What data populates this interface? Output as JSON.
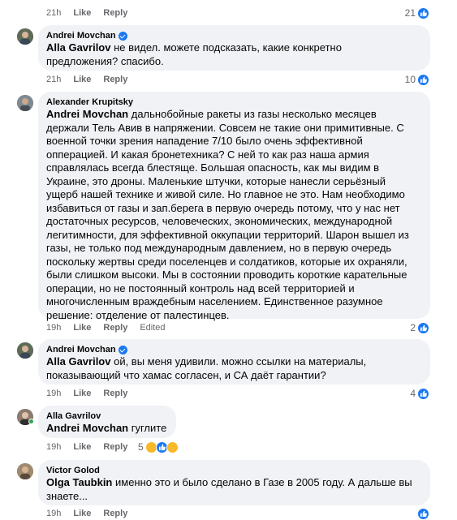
{
  "comments": [
    {
      "meta": {
        "time": "21h",
        "like": "Like",
        "reply": "Reply",
        "count": "21"
      }
    },
    {
      "author": "Andrei Movchan",
      "mention": "Alla Gavrilov",
      "body_lines": [
        " не видел. можете подсказать, какие конкретно",
        "предложения? спасибо."
      ],
      "meta": {
        "time": "21h",
        "like": "Like",
        "reply": "Reply",
        "count": "10"
      }
    },
    {
      "author": "Alexander Krupitsky",
      "mention": "Andrei Movchan",
      "body_lines": [
        " дальнобойные ракеты из газы несколько месяцев",
        "держали Тель Авив в напряжении. Совсем не такие они примитивные. С",
        "военной точки зрения нападение 7/10 было очень эффективной",
        "опперацией. И какая бронетехника? С ней то как раз наша армия",
        "справлялась всегда блестяще. Большая опасность, как мы видим в",
        "Украине, это дроны. Маленькие штучки, которые нанесли серьёзный",
        "ущерб нашей технике и живой силе. Но главное не это. Нам необходимо",
        "избавиться от газы и зап.берега в первую очередь потому, что у нас нет",
        "достаточных ресурсов, человеческих, экономических, международной",
        "легитимности, для эффективной оккупации территорий. Шарон вышел из",
        "газы, не только под международным давлением, но в первую очередь",
        "поскольку жертвы среди поселенцев и солдатиков, которые их охраняли,",
        "были слишком высоки. Мы в состоянии проводить короткие карательные",
        "операции, но не постоянный контроль над всей территорией и",
        "многочисленным враждебным населением. Единственное разумное",
        "решение: отделение от палестинцев."
      ],
      "meta": {
        "time": "19h",
        "like": "Like",
        "reply": "Reply",
        "edited": "Edited",
        "count": "2"
      }
    },
    {
      "author": "Andrei Movchan",
      "mention": "Alla Gavrilov",
      "body_lines": [
        " ой, вы меня удивили. можно ссылки на материалы,",
        "показывающий что хамас согласен, и СА даёт гарантии?"
      ],
      "meta": {
        "time": "19h",
        "like": "Like",
        "reply": "Reply",
        "count": "4"
      }
    },
    {
      "author": "Alla Gavrilov",
      "mention": "Andrei Movchan",
      "body_lines": [
        " гуглите"
      ],
      "meta": {
        "time": "19h",
        "like": "Like",
        "reply": "Reply",
        "count": "5"
      }
    },
    {
      "author": "Victor Golod",
      "mention": "Olga Taubkin",
      "body_lines": [
        " именно это и было сделано в Газе в 2005 году. А дальше вы",
        "знаете..."
      ],
      "meta": {
        "time": "19h",
        "like": "Like",
        "reply": "Reply",
        "count": ""
      }
    }
  ],
  "colors": {
    "like_blue": "#1877f2",
    "bubble_bg": "#f0f2f5",
    "meta_gray": "#65676b",
    "online_green": "#31a24c"
  },
  "icons": {
    "verified": "verified-badge-icon",
    "like": "thumbs-up-icon",
    "haha": "haha-emoji-icon",
    "wow": "wow-emoji-icon"
  }
}
